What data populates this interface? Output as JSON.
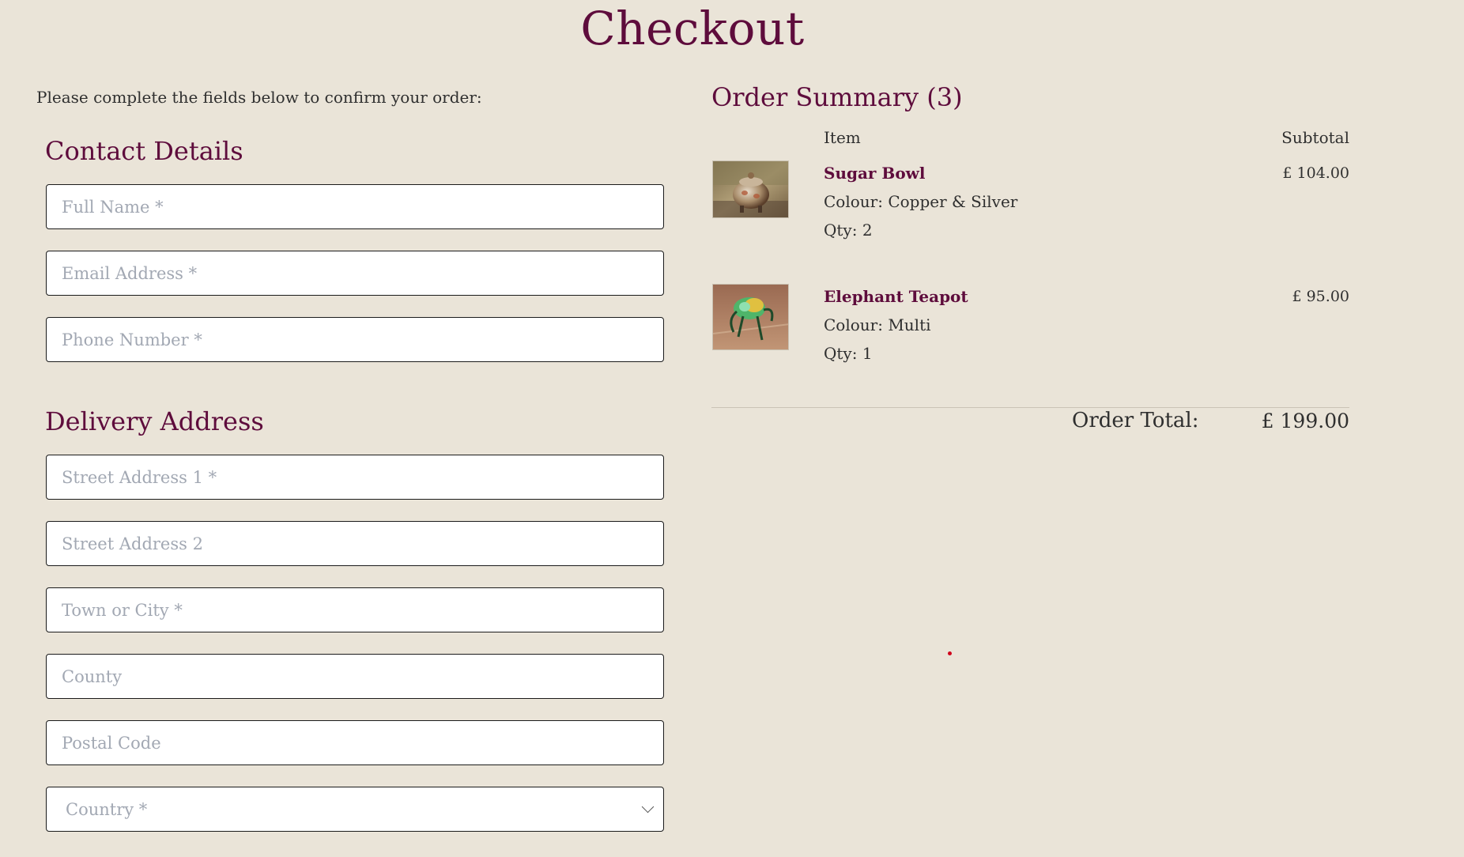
{
  "page": {
    "title": "Checkout",
    "intro": "Please complete the fields below to confirm your order:"
  },
  "contact": {
    "heading": "Contact Details",
    "full_name_placeholder": "Full Name *",
    "email_placeholder": "Email Address *",
    "phone_placeholder": "Phone Number *"
  },
  "delivery": {
    "heading": "Delivery Address",
    "street1_placeholder": "Street Address 1 *",
    "street2_placeholder": "Street Address 2",
    "town_placeholder": "Town or City *",
    "county_placeholder": "County",
    "postal_placeholder": "Postal Code",
    "country_selected": "Country *"
  },
  "summary": {
    "heading": "Order Summary (3)",
    "col_item": "Item",
    "col_subtotal": "Subtotal",
    "items": [
      {
        "name": "Sugar Bowl",
        "colour": "Colour: Copper & Silver",
        "qty": "Qty: 2",
        "price": "£ 104.00",
        "thumb": "sugar-bowl-photo"
      },
      {
        "name": "Elephant Teapot",
        "colour": "Colour: Multi",
        "qty": "Qty: 1",
        "price": "£ 95.00",
        "thumb": "elephant-teapot-photo"
      }
    ],
    "total_label": "Order Total:",
    "total_value": "£ 199.00"
  },
  "colors": {
    "background": "#eae4d8",
    "accent": "#5e0c3c",
    "placeholder": "#a2a8b3"
  }
}
